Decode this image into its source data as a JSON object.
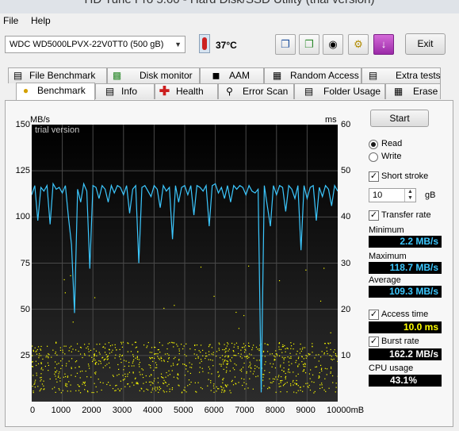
{
  "window": {
    "title": "HD Tune Pro 5.60 - Hard Disk/SSD Utility (trial version)"
  },
  "menu": {
    "file": "File",
    "help": "Help"
  },
  "toolbar": {
    "drive": "WDC WD5000LPVX-22V0TT0 (500 gB)",
    "temperature": "37°C",
    "exit_label": "Exit"
  },
  "tabs_top": [
    {
      "label": "File Benchmark",
      "icon": "file-benchmark-icon"
    },
    {
      "label": "Disk monitor",
      "icon": "disk-monitor-icon"
    },
    {
      "label": "AAM",
      "icon": "speaker-icon"
    },
    {
      "label": "Random Access",
      "icon": "random-access-icon"
    },
    {
      "label": "Extra tests",
      "icon": "extra-tests-icon"
    }
  ],
  "tabs_bottom": [
    {
      "label": "Benchmark",
      "icon": "benchmark-icon"
    },
    {
      "label": "Info",
      "icon": "info-icon"
    },
    {
      "label": "Health",
      "icon": "health-icon"
    },
    {
      "label": "Error Scan",
      "icon": "magnifier-icon"
    },
    {
      "label": "Folder Usage",
      "icon": "folder-icon"
    },
    {
      "label": "Erase",
      "icon": "trash-icon"
    }
  ],
  "controls": {
    "start_label": "Start",
    "read_label": "Read",
    "read_selected": true,
    "write_label": "Write",
    "write_selected": false,
    "short_stroke_label": "Short stroke",
    "short_stroke_checked": true,
    "short_stroke_value": "10",
    "short_stroke_unit": "gB",
    "transfer_rate_label": "Transfer rate",
    "transfer_rate_checked": true,
    "access_time_label": "Access time",
    "access_time_checked": true,
    "burst_rate_label": "Burst rate",
    "burst_rate_checked": true
  },
  "stats": {
    "minimum_label": "Minimum",
    "minimum": "2.2 MB/s",
    "maximum_label": "Maximum",
    "maximum": "118.7 MB/s",
    "average_label": "Average",
    "average": "109.3 MB/s",
    "access_time": "10.0 ms",
    "burst_rate": "162.2 MB/s",
    "cpu_label": "CPU usage",
    "cpu": "43.1%"
  },
  "colors": {
    "transfer_line": "#3cc8ff",
    "access_points": "#ffff00"
  },
  "chart_data": {
    "type": "line",
    "watermark": "trial version",
    "left_unit": "MB/s",
    "right_unit": "ms",
    "xlim": [
      0,
      10000
    ],
    "ylim_left": [
      0,
      150
    ],
    "ylim_right": [
      0,
      60
    ],
    "x_ticks": [
      "0",
      "1000",
      "2000",
      "3000",
      "4000",
      "5000",
      "6000",
      "7000",
      "8000",
      "9000",
      "10000mB"
    ],
    "y_ticks_left": [
      "150",
      "125",
      "100",
      "75",
      "50",
      "25"
    ],
    "y_ticks_right": [
      "60",
      "50",
      "40",
      "30",
      "20",
      "10"
    ],
    "grid": true,
    "series": [
      {
        "axis": "left",
        "color": "#3cc8ff",
        "x": [
          0,
          100,
          200,
          300,
          400,
          500,
          600,
          700,
          800,
          900,
          1000,
          1100,
          1200,
          1300,
          1400,
          1500,
          1600,
          1700,
          1800,
          1900,
          2000,
          2100,
          2200,
          2300,
          2400,
          2500,
          2600,
          2700,
          2800,
          2900,
          3000,
          3100,
          3200,
          3300,
          3400,
          3500,
          3600,
          3700,
          3800,
          3900,
          4000,
          4100,
          4200,
          4300,
          4400,
          4500,
          4600,
          4700,
          4800,
          4900,
          5000,
          5100,
          5200,
          5300,
          5400,
          5500,
          5600,
          5700,
          5800,
          5900,
          6000,
          6100,
          6200,
          6300,
          6400,
          6500,
          6600,
          6700,
          6800,
          6900,
          7000,
          7100,
          7200,
          7300,
          7400,
          7500,
          7600,
          7700,
          7800,
          7900,
          8000,
          8100,
          8200,
          8300,
          8400,
          8500,
          8600,
          8700,
          8800,
          8900,
          9000,
          9100,
          9200,
          9300,
          9400,
          9500,
          9600,
          9700,
          9800,
          9900,
          10000
        ],
        "y": [
          112,
          117,
          98,
          116,
          114,
          117,
          96,
          118,
          115,
          116,
          113,
          117,
          100,
          85,
          48,
          115,
          108,
          118,
          114,
          72,
          117,
          116,
          110,
          117,
          115,
          108,
          117,
          113,
          117,
          116,
          112,
          117,
          102,
          115,
          117,
          75,
          116,
          117,
          114,
          111,
          117,
          115,
          105,
          117,
          114,
          116,
          88,
          117,
          108,
          116,
          117,
          112,
          117,
          101,
          117,
          116,
          114,
          117,
          95,
          117,
          118,
          113,
          116,
          110,
          117,
          108,
          117,
          115,
          117,
          116,
          112,
          117,
          114,
          113,
          115,
          5,
          117,
          106,
          95,
          117,
          112,
          117,
          116,
          103,
          117,
          115,
          110,
          117,
          82,
          117,
          110,
          116,
          117,
          98,
          116,
          111,
          117,
          115,
          106,
          117,
          114
        ]
      },
      {
        "axis": "right",
        "color": "#ffff00",
        "points": "approx. 1000 scattered access-time samples, mostly 2–13 ms",
        "samples": 1000
      }
    ]
  }
}
